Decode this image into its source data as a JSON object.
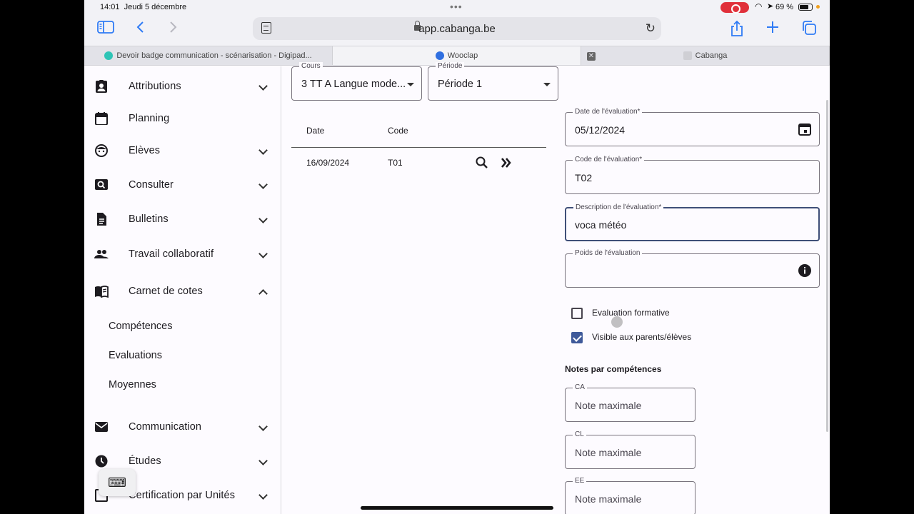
{
  "status": {
    "time": "14:01",
    "date": "Jeudi 5 décembre",
    "battery": "69 %"
  },
  "browser": {
    "url": "app.cabanga.be",
    "tabs": [
      {
        "label": "Devoir badge communication - scénarisation - Digipad...",
        "color": "#2ec4b6"
      },
      {
        "label": "Wooclap",
        "color": "#2f6fe0"
      },
      {
        "label": "",
        "color": "#666666"
      },
      {
        "label": "Cabanga",
        "color": "#cfcfd4"
      }
    ]
  },
  "sidebar": {
    "items": [
      {
        "label": "Attributions",
        "icon": "clipboard-account-icon",
        "expandable": true
      },
      {
        "label": "Planning",
        "icon": "calendar-icon",
        "expandable": false
      },
      {
        "label": "Elèves",
        "icon": "face-icon",
        "expandable": true
      },
      {
        "label": "Consulter",
        "icon": "screen-search-icon",
        "expandable": true
      },
      {
        "label": "Bulletins",
        "icon": "document-icon",
        "expandable": true
      },
      {
        "label": "Travail collaboratif",
        "icon": "people-icon",
        "expandable": true
      },
      {
        "label": "Carnet de cotes",
        "icon": "open-book-icon",
        "expandable": true,
        "expanded": true
      },
      {
        "label": "Communication",
        "icon": "mail-icon",
        "expandable": true
      },
      {
        "label": "Études",
        "icon": "clock-icon",
        "expandable": true
      },
      {
        "label": "Certification par Unités",
        "icon": "certificate-icon",
        "expandable": true
      }
    ],
    "subitems": [
      "Compétences",
      "Evaluations",
      "Moyennes"
    ]
  },
  "filters": {
    "course_label": "Cours",
    "course_value": "3 TT A Langue mode...",
    "period_label": "Période",
    "period_value": "Période 1"
  },
  "table": {
    "headers": {
      "date": "Date",
      "code": "Code"
    },
    "rows": [
      {
        "date": "16/09/2024",
        "code": "T01"
      }
    ]
  },
  "form": {
    "date_label": "Date de l'évaluation*",
    "date_value": "05/12/2024",
    "code_label": "Code de l'évaluation*",
    "code_value": "T02",
    "desc_label": "Description de l'évaluation*",
    "desc_value": "voca météo",
    "weight_label": "Poids de l'évaluation",
    "weight_value": "",
    "formative_label": "Evaluation formative",
    "formative_checked": false,
    "visible_label": "Visible aux parents/élèves",
    "visible_checked": true,
    "competences_title": "Notes par compétences",
    "competences": [
      {
        "label": "CA",
        "placeholder": "Note maximale"
      },
      {
        "label": "CL",
        "placeholder": "Note maximale"
      },
      {
        "label": "EE",
        "placeholder": "Note maximale"
      }
    ]
  }
}
